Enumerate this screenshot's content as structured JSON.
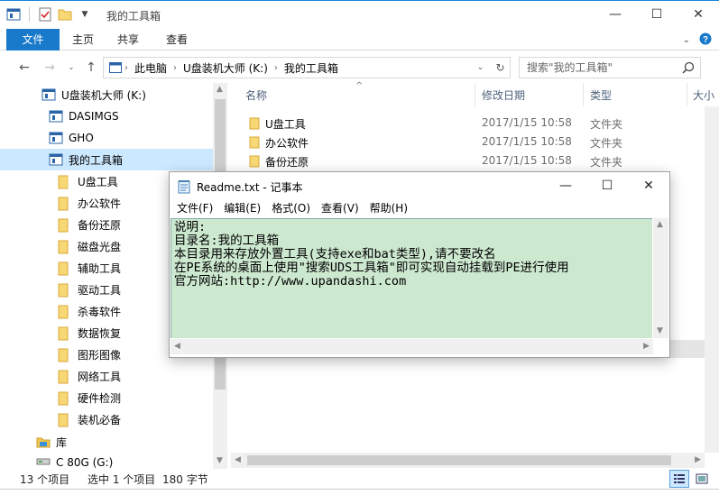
{
  "window": {
    "title": "我的工具箱"
  },
  "ribbon": {
    "tabs": [
      "文件",
      "主页",
      "共享",
      "查看"
    ]
  },
  "address": {
    "crumbs": [
      "此电脑",
      "U盘装机大师 (K:)",
      "我的工具箱"
    ],
    "search_placeholder": "搜索\"我的工具箱\""
  },
  "nav": {
    "items": [
      {
        "label": "U盘装机大师 (K:)",
        "icon": "usb-drive-icon"
      },
      {
        "label": "DASIMGS",
        "icon": "usb-drive-icon"
      },
      {
        "label": "GHO",
        "icon": "usb-drive-icon"
      },
      {
        "label": "我的工具箱",
        "icon": "usb-drive-icon"
      },
      {
        "label": "U盘工具",
        "icon": "folder-icon"
      },
      {
        "label": "办公软件",
        "icon": "folder-icon"
      },
      {
        "label": "备份还原",
        "icon": "folder-icon"
      },
      {
        "label": "磁盘光盘",
        "icon": "folder-icon"
      },
      {
        "label": "辅助工具",
        "icon": "folder-icon"
      },
      {
        "label": "驱动工具",
        "icon": "folder-icon"
      },
      {
        "label": "杀毒软件",
        "icon": "folder-icon"
      },
      {
        "label": "数据恢复",
        "icon": "folder-icon"
      },
      {
        "label": "图形图像",
        "icon": "folder-icon"
      },
      {
        "label": "网络工具",
        "icon": "folder-icon"
      },
      {
        "label": "硬件检测",
        "icon": "folder-icon"
      },
      {
        "label": "装机必备",
        "icon": "folder-icon"
      },
      {
        "label": "库",
        "icon": "library-icon"
      },
      {
        "label": "C 80G (G:)",
        "icon": "drive-icon"
      }
    ]
  },
  "columns": {
    "name": "名称",
    "date": "修改日期",
    "type": "类型",
    "size": "大小"
  },
  "files": [
    {
      "name": "U盘工具",
      "date": "2017/1/15 10:58",
      "type": "文件夹"
    },
    {
      "name": "办公软件",
      "date": "2017/1/15 10:58",
      "type": "文件夹"
    },
    {
      "name": "备份还原",
      "date": "2017/1/15 10:58",
      "type": "文件夹"
    }
  ],
  "status": {
    "count": "13 个项目",
    "selected": "选中 1 个项目",
    "size": "180 字节"
  },
  "notepad": {
    "title": "Readme.txt - 记事本",
    "menu": [
      "文件(F)",
      "编辑(E)",
      "格式(O)",
      "查看(V)",
      "帮助(H)"
    ],
    "lines": [
      "说明:",
      "目录名:我的工具箱",
      "本目录用来存放外置工具(支持exe和bat类型),请不要改名",
      "在PE系统的桌面上使用\"搜索UDS工具箱\"即可实现自动挂载到PE进行使用",
      "官方网站:http://www.upandashi.com"
    ]
  },
  "colors": {
    "accent": "#1979ca",
    "selection": "#cce8ff",
    "notepad_bg": "#cce8cf",
    "folder": "#f8d775"
  }
}
